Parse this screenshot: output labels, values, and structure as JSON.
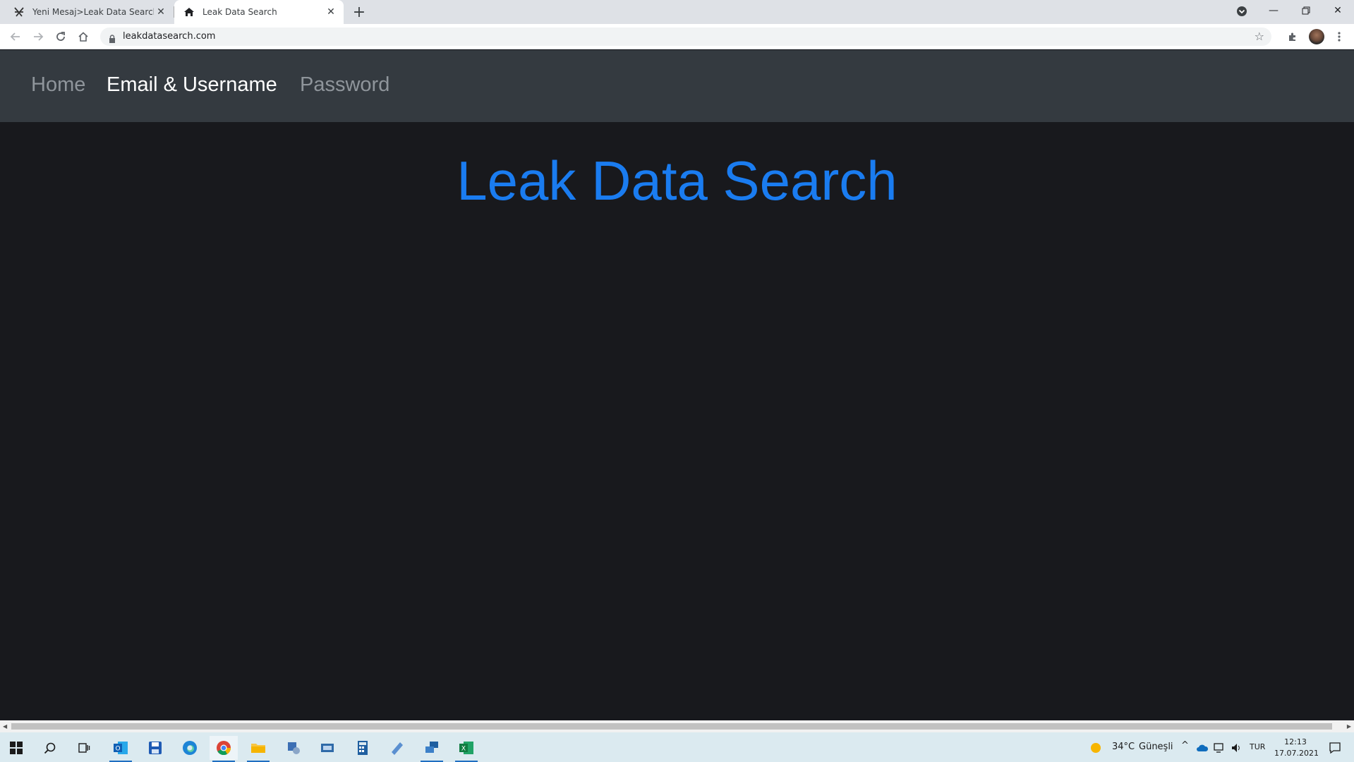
{
  "browser": {
    "tabs": [
      {
        "title": "Yeni Mesaj>Leak Data Search",
        "icon": "site-logo-icon",
        "active": false
      },
      {
        "title": "Leak Data Search",
        "icon": "home-icon",
        "active": true
      }
    ],
    "new_tab_label": "+",
    "address_url": "leakdatasearch.com"
  },
  "site": {
    "nav": {
      "home": "Home",
      "email_username": "Email & Username",
      "password": "Password"
    },
    "active_nav": "email_username",
    "title": "Leak Data Search",
    "title_color": "#1a7cf0"
  },
  "taskbar": {
    "weather": {
      "temp": "34°C",
      "condition": "Güneşli"
    },
    "language": "TUR",
    "time": "12:13",
    "date": "17.07.2021",
    "apps": [
      "start-icon",
      "search-icon",
      "task-view-icon",
      "outlook-icon",
      "save-icon",
      "edge-icon",
      "chrome-icon",
      "file-explorer-icon",
      "app-icon",
      "app-icon",
      "calculator-icon",
      "app-icon",
      "app-icon",
      "excel-icon"
    ]
  }
}
